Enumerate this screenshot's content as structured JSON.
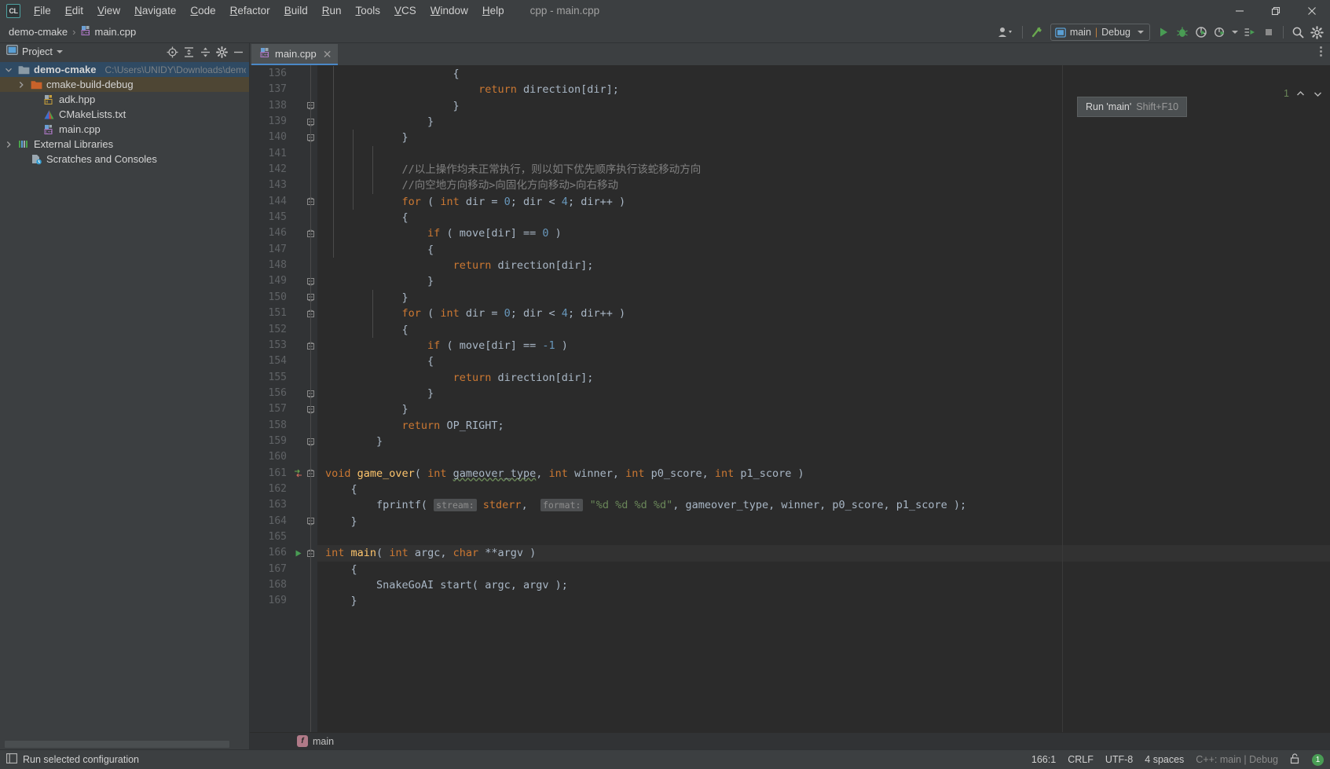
{
  "window": {
    "title": "cpp - main.cpp",
    "app_icon": "clion-logo-icon",
    "minimize": "minimize-icon",
    "maximize": "restore-icon",
    "close": "close-icon"
  },
  "menubar": {
    "items": [
      "File",
      "Edit",
      "View",
      "Navigate",
      "Code",
      "Refactor",
      "Build",
      "Run",
      "Tools",
      "VCS",
      "Window",
      "Help"
    ]
  },
  "navbar": {
    "breadcrumbs": [
      "demo-cmake",
      "main.cpp"
    ],
    "separator": "›",
    "run_config": {
      "name": "main",
      "sep": "|",
      "mode": "Debug"
    },
    "buttons": [
      "user-avatar-icon",
      "hammer-build-icon",
      "run-icon",
      "debug-icon",
      "run-with-coverage-icon",
      "profile-icon",
      "attach-to-process-icon",
      "stop-icon",
      "search-everywhere-icon",
      "settings-gear-icon"
    ]
  },
  "tooltip": {
    "text": "Run 'main'",
    "shortcut": "Shift+F10"
  },
  "sidebar": {
    "title": "Project",
    "toolbar_icons": [
      "locate-target-icon",
      "expand-all-icon",
      "collapse-all-icon",
      "settings-gear-icon",
      "hide-panel-icon"
    ],
    "tree": [
      {
        "label": "demo-cmake",
        "path": "C:\\Users\\UNIDY\\Downloads\\demo-cm",
        "icon": "project-folder-icon",
        "indent": 0,
        "arrow": "expanded",
        "selected": "blue"
      },
      {
        "label": "cmake-build-debug",
        "path": "",
        "icon": "excluded-folder-icon",
        "indent": 1,
        "arrow": "collapsed",
        "selected": "amber"
      },
      {
        "label": "adk.hpp",
        "path": "",
        "icon": "header-file-icon",
        "indent": 2,
        "arrow": "none",
        "selected": "none"
      },
      {
        "label": "CMakeLists.txt",
        "path": "",
        "icon": "cmake-file-icon",
        "indent": 2,
        "arrow": "none",
        "selected": "none"
      },
      {
        "label": "main.cpp",
        "path": "",
        "icon": "cpp-file-icon",
        "indent": 2,
        "arrow": "none",
        "selected": "none"
      },
      {
        "label": "External Libraries",
        "path": "",
        "icon": "libraries-icon",
        "indent": 0,
        "arrow": "collapsed",
        "selected": "none"
      },
      {
        "label": "Scratches and Consoles",
        "path": "",
        "icon": "scratches-icon",
        "indent": 1,
        "arrow": "none",
        "selected": "none"
      }
    ]
  },
  "editor": {
    "tab": {
      "label": "main.cpp",
      "icon": "cpp-file-icon",
      "close": "close-icon"
    },
    "first_line": 136,
    "current_line": 166,
    "inspection": {
      "count": "1",
      "up": "prev-problem-icon",
      "down": "next-problem-icon"
    },
    "struct_bar": {
      "badge": "f",
      "label": "main"
    },
    "lines": [
      {
        "n": 136,
        "fold": "none",
        "run": "none",
        "html": "                    {"
      },
      {
        "n": 137,
        "fold": "none",
        "run": "none",
        "html": "                        <span class=\"kw\">return</span> direction[dir];"
      },
      {
        "n": 138,
        "fold": "end",
        "run": "none",
        "html": "                    }"
      },
      {
        "n": 139,
        "fold": "end",
        "run": "none",
        "html": "                }"
      },
      {
        "n": 140,
        "fold": "end",
        "run": "none",
        "html": "            }"
      },
      {
        "n": 141,
        "fold": "none",
        "run": "none",
        "html": ""
      },
      {
        "n": 142,
        "fold": "none",
        "run": "none",
        "html": "            <span class=\"cmt\">//以上操作均未正常执行，则以如下优先顺序执行该蛇移动方向</span>"
      },
      {
        "n": 143,
        "fold": "none",
        "run": "none",
        "html": "            <span class=\"cmt\">//向空地方向移动>向固化方向移动>向右移动</span>"
      },
      {
        "n": 144,
        "fold": "start",
        "run": "none",
        "html": "            <span class=\"kw\">for</span> ( <span class=\"kw\">int</span> dir = <span class=\"num\">0</span>; dir &lt; <span class=\"num\">4</span>; dir++ )"
      },
      {
        "n": 145,
        "fold": "none",
        "run": "none",
        "html": "            {"
      },
      {
        "n": 146,
        "fold": "start",
        "run": "none",
        "html": "                <span class=\"kw\">if</span> ( move[dir] == <span class=\"num\">0</span> )"
      },
      {
        "n": 147,
        "fold": "none",
        "run": "none",
        "html": "                {"
      },
      {
        "n": 148,
        "fold": "none",
        "run": "none",
        "html": "                    <span class=\"kw\">return</span> direction[dir];"
      },
      {
        "n": 149,
        "fold": "end",
        "run": "none",
        "html": "                }"
      },
      {
        "n": 150,
        "fold": "end",
        "run": "none",
        "html": "            }"
      },
      {
        "n": 151,
        "fold": "start",
        "run": "none",
        "html": "            <span class=\"kw\">for</span> ( <span class=\"kw\">int</span> dir = <span class=\"num\">0</span>; dir &lt; <span class=\"num\">4</span>; dir++ )"
      },
      {
        "n": 152,
        "fold": "none",
        "run": "none",
        "html": "            {"
      },
      {
        "n": 153,
        "fold": "start",
        "run": "none",
        "html": "                <span class=\"kw\">if</span> ( move[dir] == <span class=\"num\">-1</span> )"
      },
      {
        "n": 154,
        "fold": "none",
        "run": "none",
        "html": "                {"
      },
      {
        "n": 155,
        "fold": "none",
        "run": "none",
        "html": "                    <span class=\"kw\">return</span> direction[dir];"
      },
      {
        "n": 156,
        "fold": "end",
        "run": "none",
        "html": "                }"
      },
      {
        "n": 157,
        "fold": "end",
        "run": "none",
        "html": "            }"
      },
      {
        "n": 158,
        "fold": "none",
        "run": "none",
        "html": "            <span class=\"kw\">return</span> OP_RIGHT;"
      },
      {
        "n": 159,
        "fold": "end",
        "run": "none",
        "html": "        }"
      },
      {
        "n": 160,
        "fold": "none",
        "run": "none",
        "html": ""
      },
      {
        "n": 161,
        "fold": "start",
        "run": "override",
        "html": "<span class=\"kw\">void</span> <span class=\"fn\">game_over</span>( <span class=\"kw\">int</span> <span class=\"warnul\">gameover_type</span>, <span class=\"kw\">int</span> winner, <span class=\"kw\">int</span> p0_score, <span class=\"kw\">int</span> p1_score )"
      },
      {
        "n": 162,
        "fold": "none",
        "run": "none",
        "html": "    {"
      },
      {
        "n": 163,
        "fold": "none",
        "run": "none",
        "html": "        fprintf( <span class=\"hintbg\">stream:</span> <span class=\"kw\">stderr</span>,  <span class=\"hintbg\">format:</span> <span class=\"str\">\"%d %d %d %d\"</span>, gameover_type, winner, p0_score, p1_score );"
      },
      {
        "n": 164,
        "fold": "end",
        "run": "none",
        "html": "    }"
      },
      {
        "n": 165,
        "fold": "none",
        "run": "none",
        "html": ""
      },
      {
        "n": 166,
        "fold": "start",
        "run": "run",
        "current": true,
        "html": "<span class=\"kw\">int</span> <span class=\"fn\">main</span>( <span class=\"kw\">int</span> argc, <span class=\"kw\">char</span> **argv )"
      },
      {
        "n": 167,
        "fold": "none",
        "run": "none",
        "html": "    {"
      },
      {
        "n": 168,
        "fold": "none",
        "run": "none",
        "html": "        SnakeGoAI start( argc, argv );"
      },
      {
        "n": 169,
        "fold": "none",
        "run": "none",
        "html": "    }"
      }
    ]
  },
  "statusbar": {
    "left_icon": "toggle-tool-window-icon",
    "left_text": "Run selected configuration",
    "caret": "166:1",
    "line_sep": "CRLF",
    "encoding": "UTF-8",
    "indent": "4 spaces",
    "context": "C++: main | Debug",
    "lock_icon": "read-write-lock-icon",
    "notification_count": "1"
  },
  "colors": {
    "accent_blue": "#4a88c7",
    "run_green": "#499c54",
    "selection_blue": "#2f4a63",
    "selection_amber": "#4e4634",
    "editor_bg": "#2b2b2b",
    "panel_bg": "#3c3f41",
    "keyword_orange": "#cc7832",
    "number_blue": "#6897bb",
    "string_green": "#6a8759",
    "function_yellow": "#ffc66d",
    "comment_gray": "#808080"
  }
}
